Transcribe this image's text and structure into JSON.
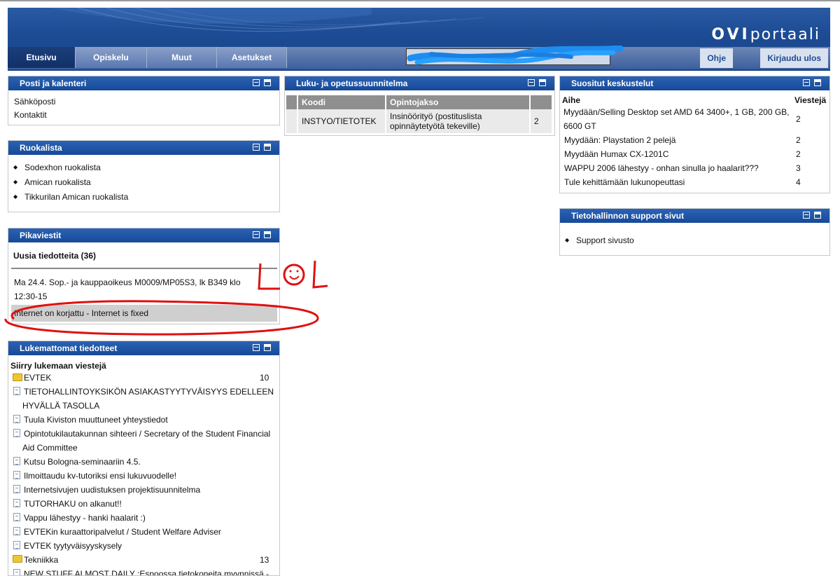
{
  "header": {
    "logo_bold": "OVI",
    "logo_rest": "portaali",
    "tabs": [
      "Etusivu",
      "Opiskelu",
      "Muut",
      "Asetukset"
    ],
    "help": "Ohje",
    "logout": "Kirjaudu ulos"
  },
  "posti": {
    "title": "Posti ja kalenteri",
    "items": [
      "Sähköposti",
      "Kontaktit"
    ]
  },
  "ruokalista": {
    "title": "Ruokalista",
    "items": [
      "Sodexhon ruokalista",
      "Amican ruokalista",
      "Tikkurilan Amican ruokalista"
    ]
  },
  "pikaviestit": {
    "title": "Pikaviestit",
    "subtitle": "Uusia tiedotteita (36)",
    "msg1_line1": "Ma 24.4. Sop.- ja kauppaoikeus M0009/MP05S3, lk B349 klo",
    "msg1_line2": "12:30-15",
    "msg2": "Internet on korjattu - Internet is fixed"
  },
  "annotation": {
    "text": "LOL"
  },
  "lukemattomat": {
    "title": "Lukemattomat tiedotteet",
    "subtitle": "Siirry lukemaan viestejä",
    "items": [
      {
        "text": "EVTEK",
        "count": "10",
        "type": "folder"
      },
      {
        "text": "TIETOHALLINTOYKSIKÖN ASIAKASTYYTYVÄISYYS EDELLEEN",
        "text2": "HYVÄLLÄ TASOLLA",
        "type": "doc"
      },
      {
        "text": "Tuula Kiviston muuttuneet yhteystiedot",
        "type": "doc"
      },
      {
        "text": "Opintotukilautakunnan sihteeri / Secretary of the Student Financial",
        "text2": "Aid Committee",
        "type": "doc"
      },
      {
        "text": "Kutsu Bologna-seminaariin 4.5.",
        "type": "doc"
      },
      {
        "text": "Ilmoittaudu kv-tutoriksi ensi lukuvuodelle!",
        "type": "doc"
      },
      {
        "text": "Internetsivujen uudistuksen projektisuunnitelma",
        "type": "doc"
      },
      {
        "text": "TUTORHAKU on alkanut!!",
        "type": "doc"
      },
      {
        "text": "Vappu lähestyy - hanki haalarit :)",
        "type": "doc"
      },
      {
        "text": "EVTEKin kuraattoripalvelut / Student Welfare Adviser",
        "type": "doc"
      },
      {
        "text": "EVTEK tyytyväisyyskysely",
        "type": "doc"
      },
      {
        "text": "Tekniikka",
        "count": "13",
        "type": "folder"
      },
      {
        "text": "NEW STUFF ALMOST DAILY :Espoossa tietokoneita myynnissä -",
        "type": "doc"
      }
    ]
  },
  "luku": {
    "title": "Luku- ja opetussuunnitelma",
    "headers": [
      "Koodi",
      "Opintojakso"
    ],
    "row": {
      "koodi": "INSTYO/TIETOTEK",
      "opinto1": "Insinöörityö (postituslista",
      "opinto2": "opinnäytetyötä tekeville)",
      "num": "2"
    }
  },
  "suositut": {
    "title": "Suositut keskustelut",
    "col1": "Aihe",
    "col2": "Viestejä",
    "rows": [
      {
        "a1": "Myydään/Selling Desktop set AMD 64 3400+, 1 GB, 200 GB,",
        "a2": "6600 GT",
        "n": "2"
      },
      {
        "a1": "Myydään: Playstation 2 pelejä",
        "n": "2"
      },
      {
        "a1": "Myydään Humax CX-1201C",
        "n": "2"
      },
      {
        "a1": "WAPPU 2006 lähestyy - onhan sinulla jo haalarit???",
        "n": "3"
      },
      {
        "a1": "Tule kehittämään lukunopeuttasi",
        "n": "4"
      }
    ]
  },
  "support": {
    "title": "Tietohallinnon support sivut",
    "item": "Support sivusto"
  }
}
